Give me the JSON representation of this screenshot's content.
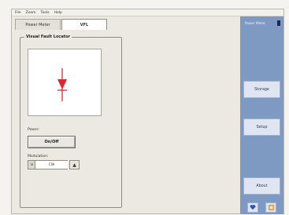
{
  "menu": [
    "File",
    "Zoom",
    "Tools",
    "Help"
  ],
  "tabs": [
    {
      "label": "Power Meter",
      "active": false
    },
    {
      "label": "VFL",
      "active": true
    }
  ],
  "vfl": {
    "group_title": "Visual Fault Locator",
    "power_label": "Power:",
    "onoff_label": "On/Off",
    "modulation_label": "Modulation:",
    "modulation_value": "CW",
    "mod_down_symbol": "⇲",
    "mod_up_symbol": "▲",
    "indicator_icon": "laser-indicator-icon",
    "indicator_color": "#e8232a"
  },
  "sidebar": {
    "header_label": "Power Meter",
    "buttons": [
      {
        "label": "Storage"
      },
      {
        "label": "Setup"
      },
      {
        "label": "About"
      }
    ],
    "footer_icons": [
      "heart-icon",
      "square-icon"
    ],
    "colors": {
      "background": "#7f9ac2",
      "button": "#dfe6f2",
      "orange_icon": "#f29a2e",
      "blue_icon": "#2b56b7"
    }
  }
}
